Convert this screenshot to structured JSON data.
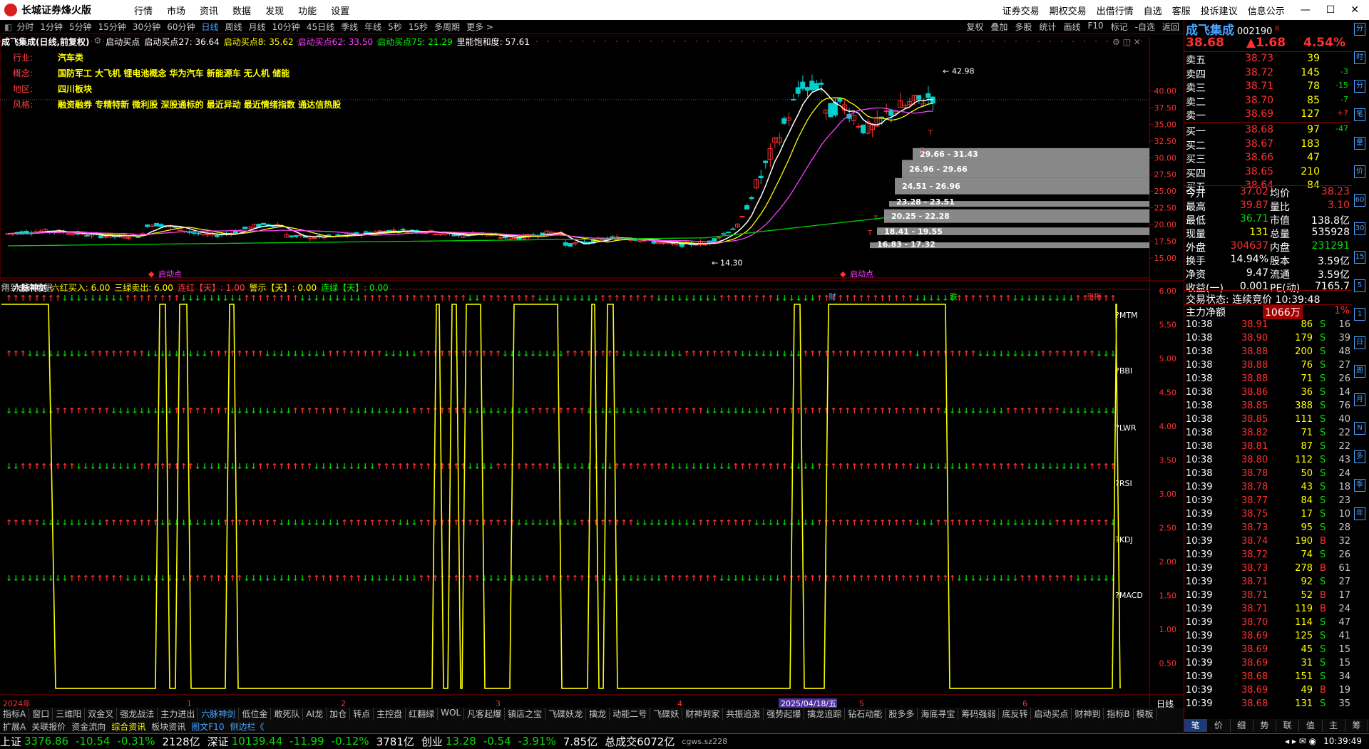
{
  "app": {
    "title": "长城证券烽火版",
    "menus": [
      "行情",
      "市场",
      "资讯",
      "数据",
      "发现",
      "功能",
      "设置"
    ],
    "right_menus": [
      "证券交易",
      "期权交易",
      "出借行情",
      "自选",
      "客服",
      "投诉建议",
      "信息公示"
    ]
  },
  "periods": [
    "分时",
    "1分钟",
    "5分钟",
    "15分钟",
    "30分钟",
    "60分钟",
    "日线",
    "周线",
    "月线",
    "10分钟",
    "45日线",
    "季线",
    "年线",
    "5秒",
    "15秒",
    "多周期",
    "更多 >"
  ],
  "tools": [
    "复权",
    "叠加",
    "多股",
    "统计",
    "画线",
    "F10",
    "标记",
    "-自选",
    "返回"
  ],
  "chart_header": {
    "name": "成飞集成(日线,前复权)",
    "items": [
      {
        "t": "启动买点",
        "c": "#ffffff"
      },
      {
        "t": "启动买点27: 36.64",
        "c": "#ffffff"
      },
      {
        "t": "启动买点8: 35.62",
        "c": "#ffff00"
      },
      {
        "t": "启动买点62: 33.50",
        "c": "#ff40ff"
      },
      {
        "t": "启动买点75: 21.29",
        "c": "#00ff00"
      },
      {
        "t": "里能饱和度: 57.61",
        "c": "#ffffff"
      }
    ]
  },
  "tags": [
    {
      "label": "行业:",
      "value": "汽车类"
    },
    {
      "label": "概念:",
      "value": "国防军工 大飞机 锂电池概念 华为汽车 新能源车 无人机 储能"
    },
    {
      "label": "地区:",
      "value": "四川板块"
    },
    {
      "label": "风格:",
      "value": "融资融券 专精特新 微利股 深股通标的 最近异动 最近情绪指数 通达信热股"
    }
  ],
  "main_axis": [
    "40.00",
    "37.50",
    "35.00",
    "32.50",
    "30.00",
    "27.50",
    "25.00",
    "22.50",
    "20.00",
    "17.50",
    "15.00"
  ],
  "price_labels": {
    "high": "42.98",
    "low": "14.30"
  },
  "volume_profile": [
    "29.66 - 31.43",
    "26.96 - 29.66",
    "24.51 - 26.96",
    "23.28 - 23.51",
    "20.25 - 22.28",
    "18.41 - 19.55",
    "16.83 - 17.32"
  ],
  "markers": {
    "qidong1": "启动点",
    "qidong2": "启动点",
    "future_note": "用到未来数据",
    "cai": "财",
    "die": "跌",
    "zhangting": "涨梅"
  },
  "sub_header": {
    "name": "六脉神剑",
    "items": [
      {
        "t": "六红买入: 6.00",
        "c": "#ffff00"
      },
      {
        "t": "三绿卖出: 6.00",
        "c": "#ffff00"
      },
      {
        "t": "连红【天】: 1.00",
        "c": "#ff4040"
      },
      {
        "t": "警示【天】: 0.00",
        "c": "#ffff00"
      },
      {
        "t": "连绿【天】: 0.00",
        "c": "#00ff00"
      }
    ]
  },
  "sub_axis": [
    "6.00",
    "5.50",
    "5.00",
    "4.50",
    "4.00",
    "3.50",
    "3.00",
    "2.50",
    "2.00",
    "1.50",
    "1.00",
    "0.50"
  ],
  "sub_labels": [
    "?MTM",
    "?BBI",
    "?LWR",
    "?RSI",
    "?KDJ",
    "?MACD"
  ],
  "dates": {
    "d0": "2024年",
    "m1": "1",
    "m2": "2",
    "m3": "3",
    "m4": "4",
    "sel": "2025/04/18/五",
    "m5": "5",
    "m6": "6",
    "period": "日线"
  },
  "quote": {
    "name": "成飞集成",
    "code": "002190",
    "flag": "R",
    "price": "38.68",
    "change": "▲1.68",
    "pct": "4.54%"
  },
  "asks": [
    [
      "卖五",
      "38.73",
      "39",
      ""
    ],
    [
      "卖四",
      "38.72",
      "145",
      "-3"
    ],
    [
      "卖三",
      "38.71",
      "78",
      "-15"
    ],
    [
      "卖二",
      "38.70",
      "85",
      "-7"
    ],
    [
      "卖一",
      "38.69",
      "127",
      "+7"
    ]
  ],
  "bids": [
    [
      "买一",
      "38.68",
      "97",
      "-47"
    ],
    [
      "买二",
      "38.67",
      "183",
      ""
    ],
    [
      "买三",
      "38.66",
      "47",
      ""
    ],
    [
      "买四",
      "38.65",
      "210",
      ""
    ],
    [
      "买五",
      "38.64",
      "84",
      ""
    ]
  ],
  "stats": [
    [
      "今开",
      "37.02",
      "均价",
      "38.23"
    ],
    [
      "最高",
      "39.87",
      "量比",
      "3.10"
    ],
    [
      "最低",
      "36.71",
      "市值",
      "138.8亿"
    ],
    [
      "现量",
      "131",
      "总量",
      "535928"
    ],
    [
      "外盘",
      "304637",
      "内盘",
      "231291"
    ],
    [
      "换手",
      "14.94%",
      "股本",
      "3.59亿"
    ],
    [
      "净资",
      "9.47",
      "流通",
      "3.59亿"
    ],
    [
      "收益(一)",
      "0.001",
      "PE(动)",
      "7165.7"
    ]
  ],
  "trade_state": "交易状态: 连续竞价 10:39:48",
  "main_net": {
    "label": "主力净额",
    "value": "1066万",
    "pct": "1%"
  },
  "ticks": [
    [
      "10:38",
      "38.91",
      "86",
      "S",
      "16"
    ],
    [
      "10:38",
      "38.90",
      "179",
      "S",
      "39"
    ],
    [
      "10:38",
      "38.88",
      "200",
      "S",
      "48"
    ],
    [
      "10:38",
      "38.88",
      "76",
      "S",
      "27"
    ],
    [
      "10:38",
      "38.88",
      "71",
      "S",
      "26"
    ],
    [
      "10:38",
      "38.86",
      "36",
      "S",
      "14"
    ],
    [
      "10:38",
      "38.85",
      "388",
      "S",
      "76"
    ],
    [
      "10:38",
      "38.85",
      "111",
      "S",
      "40"
    ],
    [
      "10:38",
      "38.82",
      "71",
      "S",
      "22"
    ],
    [
      "10:38",
      "38.81",
      "87",
      "S",
      "22"
    ],
    [
      "10:38",
      "38.80",
      "112",
      "S",
      "43"
    ],
    [
      "10:38",
      "38.78",
      "50",
      "S",
      "24"
    ],
    [
      "10:39",
      "38.78",
      "43",
      "S",
      "18"
    ],
    [
      "10:39",
      "38.77",
      "84",
      "S",
      "23"
    ],
    [
      "10:39",
      "38.75",
      "17",
      "S",
      "10"
    ],
    [
      "10:39",
      "38.73",
      "95",
      "S",
      "28"
    ],
    [
      "10:39",
      "38.74",
      "190",
      "B",
      "32"
    ],
    [
      "10:39",
      "38.72",
      "74",
      "S",
      "26"
    ],
    [
      "10:39",
      "38.73",
      "278",
      "B",
      "61"
    ],
    [
      "10:39",
      "38.71",
      "92",
      "S",
      "27"
    ],
    [
      "10:39",
      "38.71",
      "52",
      "B",
      "17"
    ],
    [
      "10:39",
      "38.71",
      "119",
      "B",
      "24"
    ],
    [
      "10:39",
      "38.70",
      "114",
      "S",
      "47"
    ],
    [
      "10:39",
      "38.69",
      "125",
      "S",
      "41"
    ],
    [
      "10:39",
      "38.69",
      "45",
      "S",
      "15"
    ],
    [
      "10:39",
      "38.69",
      "31",
      "S",
      "15"
    ],
    [
      "10:39",
      "38.68",
      "151",
      "S",
      "34"
    ],
    [
      "10:39",
      "38.69",
      "49",
      "B",
      "19"
    ],
    [
      "10:39",
      "38.68",
      "131",
      "S",
      "35"
    ]
  ],
  "side_icons": [
    "分",
    "时",
    "分",
    "笔",
    "量",
    "价",
    "60",
    "30",
    "15",
    "5",
    "1",
    "日",
    "周",
    "月",
    "N",
    "多",
    "季",
    "年"
  ],
  "bottom_tabs": [
    "指标A",
    "窗口",
    "三维阳",
    "双金叉",
    "强龙战法",
    "主力进出",
    "六脉神剑",
    "低位金",
    "敢死队",
    "AI龙",
    "加仓",
    "转点",
    "主控盘",
    "红翻绿",
    "WOL",
    "凡客起爆",
    "镇店之宝",
    "飞碟妖龙",
    "擒龙",
    "动能二号",
    "飞碟妖",
    "财神到家",
    "共振追涨",
    "强势起爆",
    "擒龙追踪",
    "钻石动能",
    "股多多",
    "海底寻宝",
    "筹码强弱",
    "底反转",
    "启动买点",
    "财神到",
    "指标B",
    "模板"
  ],
  "bottom_tabs2": [
    "扩展A",
    "关联报价",
    "资金流向",
    "综合资讯",
    "板块资讯",
    "图文F10",
    "侧边栏《"
  ],
  "right_tabs": [
    "笔",
    "价",
    "细",
    "势",
    "联",
    "值",
    "主",
    "筹"
  ],
  "status": {
    "sh": "上证",
    "sh_v": "3376.86",
    "sh_c": "-10.54",
    "sh_p": "-0.31%",
    "sh_a": "2128亿",
    "sz": "深证",
    "sz_v": "10139.44",
    "sz_c": "-11.99",
    "sz_p": "-0.12%",
    "sz_a": "3781亿",
    "cy": "创业",
    "cy_v": "13.28",
    "cy_c": "-0.54",
    "cy_p": "-3.91%",
    "cy_a": "7.85亿",
    "total": "总成交6072亿",
    "server": "cgws.sz228",
    "time": "10:39:49"
  },
  "colors": {
    "up": "#ff3030",
    "down": "#00d0d0",
    "yellow": "#ffff00",
    "green": "#00ff00",
    "magenta": "#ff40ff"
  }
}
